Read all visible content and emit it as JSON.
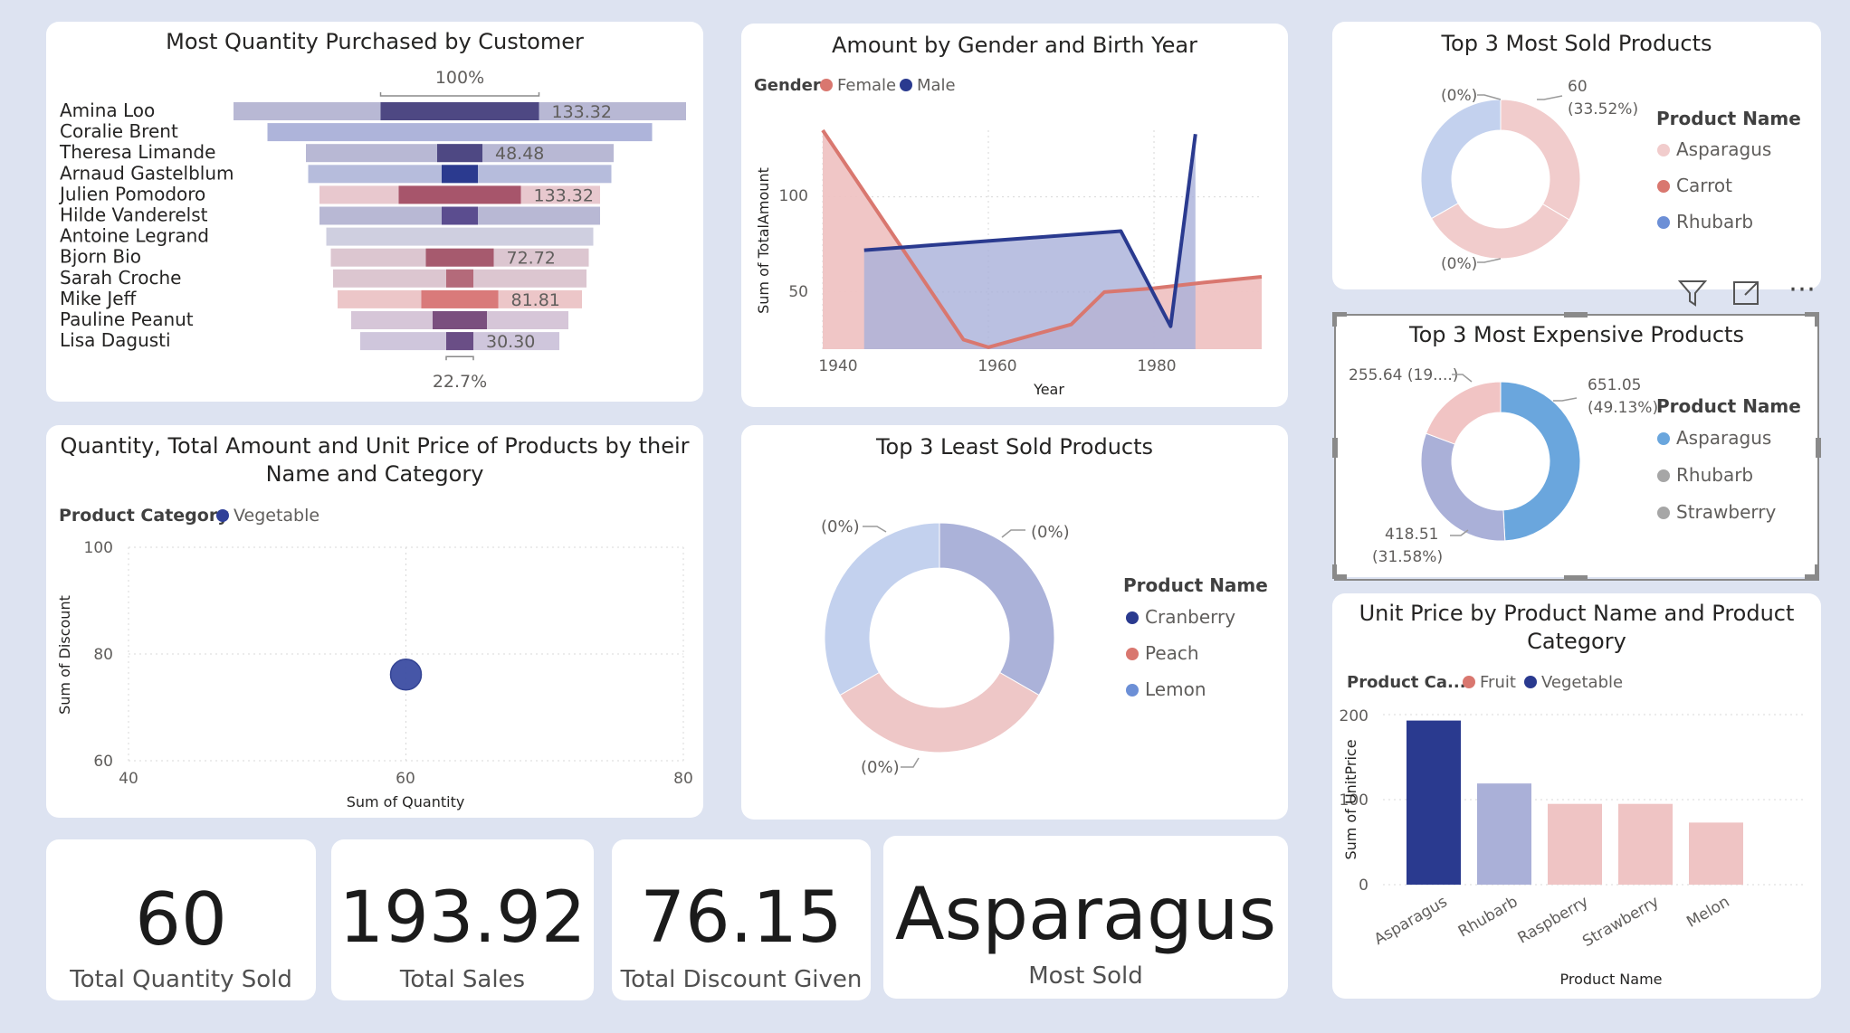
{
  "funnel": {
    "title": "Most Quantity Purchased by Customer",
    "top_label": "100%",
    "bottom_label": "22.7%"
  },
  "area": {
    "title": "Amount by Gender and Birth Year",
    "legend_title": "Gender",
    "x_ticks": [
      "1940",
      "1960",
      "1980"
    ],
    "y_ticks": [
      "100",
      "50"
    ]
  },
  "donut_sold": {
    "title": "Top 3 Most Sold Products",
    "legend_title": "Product Name",
    "labels": [
      "60",
      "(33.52%)",
      "(0%)",
      "(0%)"
    ]
  },
  "donut_exp": {
    "title": "Top 3 Most Expensive Products",
    "legend_title": "Product Name",
    "labels": [
      "651.05",
      "(49.13%)",
      "418.51",
      "(31.58%)",
      "255.64 (19....)"
    ]
  },
  "scatter": {
    "title_line1": "Quantity, Total Amount and Unit Price of Products by their",
    "title_line2": "Name and Category",
    "legend_title": "Product Category",
    "x_ticks": [
      "40",
      "60",
      "80"
    ],
    "y_ticks": [
      "100",
      "80",
      "60"
    ]
  },
  "donut_least": {
    "title": "Top 3 Least Sold Products",
    "legend_title": "Product Name",
    "labels": [
      "(0%)",
      "(0%)",
      "(0%)"
    ]
  },
  "bar": {
    "title_line1": "Unit Price by Product Name and Product",
    "title_line2": "Category",
    "legend_title": "Product Ca...",
    "y_ticks": [
      "200",
      "100",
      "0"
    ]
  },
  "kpis": [
    {
      "value": "60",
      "label": "Total Quantity Sold"
    },
    {
      "value": "193.92",
      "label": "Total Sales"
    },
    {
      "value": "76.15",
      "label": "Total Discount Given"
    },
    {
      "value": "Asparagus",
      "label": "Most Sold"
    }
  ],
  "toolbar": {
    "filter_icon": "filter-icon",
    "focus_icon": "focus-mode-icon",
    "more_icon": "more-options-icon",
    "more_glyph": "⋯"
  },
  "chart_data": [
    {
      "type": "bar",
      "subtype": "funnel",
      "title": "Most Quantity Purchased by Customer",
      "categories": [
        "Amina Loo",
        "Coralie Brent",
        "Theresa Limande",
        "Arnaud Gastelblum",
        "Julien Pomodoro",
        "Hilde Vanderelst",
        "Antoine Legrand",
        "Bjorn Bio",
        "Sarah Croche",
        "Mike Jeff",
        "Pauline Peanut",
        "Lisa Dagusti"
      ],
      "values": [
        100,
        85,
        68,
        67,
        62,
        62,
        59,
        57,
        56,
        54,
        48,
        44
      ],
      "inner_values": [
        35,
        0,
        10,
        8,
        27,
        8,
        0,
        15,
        6,
        17,
        12,
        6
      ],
      "data_labels": [
        "133.32",
        "",
        "48.48",
        "",
        "133.32",
        "",
        "",
        "72.72",
        "",
        "81.81",
        "",
        "30.30"
      ],
      "colors": [
        "#b8b8d4",
        "#aeb4da",
        "#b8b8d4",
        "#b6bcdc",
        "#e8c8ce",
        "#b8b8d4",
        "#cfcfe0",
        "#dcc6d0",
        "#dcc6d0",
        "#ecc6c8",
        "#d6c6d8",
        "#cfc6dc"
      ],
      "inner_colors": [
        "#4e4883",
        "#4e4883",
        "#4e4883",
        "#2b3a8f",
        "#a7556b",
        "#5b4d8f",
        "#4e4883",
        "#a65a6e",
        "#b46a7a",
        "#d97a7a",
        "#7a4f7e",
        "#6a4e86"
      ],
      "top_label": "100%",
      "bottom_label": "22.7%"
    },
    {
      "type": "area",
      "title": "Amount by Gender and Birth Year",
      "xlabel": "Year",
      "ylabel": "Sum of TotalAmount",
      "xlim": [
        1940,
        1993
      ],
      "ylim": [
        20,
        135
      ],
      "series": [
        {
          "name": "Female",
          "color": "#d9776f",
          "fill": "#efc3c3",
          "x": [
            1940,
            1957,
            1960,
            1965,
            1970,
            1974,
            1980,
            1986,
            1993
          ],
          "y": [
            135,
            25,
            21,
            27,
            33,
            50,
            52,
            55,
            58
          ]
        },
        {
          "name": "Male",
          "color": "#2a3a8f",
          "fill": "#a9b0d9",
          "x": [
            1945,
            1976,
            1982,
            1985
          ],
          "y": [
            72,
            82,
            32,
            133
          ]
        }
      ]
    },
    {
      "type": "pie",
      "subtype": "donut",
      "title": "Top 3 Most Sold Products",
      "legend_title": "Product Name",
      "categories": [
        "Asparagus",
        "Carrot",
        "Rhubarb"
      ],
      "values": [
        33.52,
        33.24,
        33.24
      ],
      "colors": [
        "#f1cccc",
        "#f1cccc",
        "#c3d1ee"
      ],
      "legend_colors": [
        "#f1cccc",
        "#d9776f",
        "#6c8fd6"
      ]
    },
    {
      "type": "pie",
      "subtype": "donut",
      "title": "Top 3 Most Expensive Products",
      "legend_title": "Product Name",
      "categories": [
        "Asparagus",
        "Rhubarb",
        "Strawberry"
      ],
      "values": [
        651.05,
        418.51,
        255.64
      ],
      "percents": [
        49.13,
        31.58,
        19.29
      ],
      "colors": [
        "#6aa6dd",
        "#aab0d8",
        "#f1c4c4"
      ],
      "legend_colors": [
        "#6aa6dd",
        "#a6a6a6",
        "#a6a6a6"
      ]
    },
    {
      "type": "scatter",
      "title": "Quantity, Total Amount and Unit Price of Products by their Name and Category",
      "xlabel": "Sum of Quantity",
      "ylabel": "Sum of Discount",
      "xlim": [
        40,
        80
      ],
      "ylim": [
        60,
        100
      ],
      "series": [
        {
          "name": "Vegetable",
          "color": "#2f3f98",
          "points": [
            {
              "x": 60,
              "y": 76.15
            }
          ]
        }
      ]
    },
    {
      "type": "pie",
      "subtype": "donut",
      "title": "Top 3 Least Sold Products",
      "legend_title": "Product Name",
      "categories": [
        "Cranberry",
        "Peach",
        "Lemon"
      ],
      "values": [
        33.3,
        33.3,
        33.3
      ],
      "colors": [
        "#abb2d9",
        "#eec7c7",
        "#c3d1ee"
      ],
      "legend_colors": [
        "#2a3a8f",
        "#d9776f",
        "#6c8fd6"
      ]
    },
    {
      "type": "bar",
      "title": "Unit Price by Product Name and Product Category",
      "xlabel": "Product Name",
      "ylabel": "Sum of UnitPrice",
      "ylim": [
        0,
        200
      ],
      "categories": [
        "Asparagus",
        "Rhubarb",
        "Raspberry",
        "Strawberry",
        "Melon"
      ],
      "values": [
        193,
        119,
        95,
        95,
        73
      ],
      "colors": [
        "#2a3a8f",
        "#aab0d8",
        "#efc4c4",
        "#efc4c4",
        "#efc4c4"
      ],
      "legend": [
        {
          "name": "Fruit",
          "color": "#d9776f"
        },
        {
          "name": "Vegetable",
          "color": "#2a3a8f"
        }
      ]
    }
  ]
}
